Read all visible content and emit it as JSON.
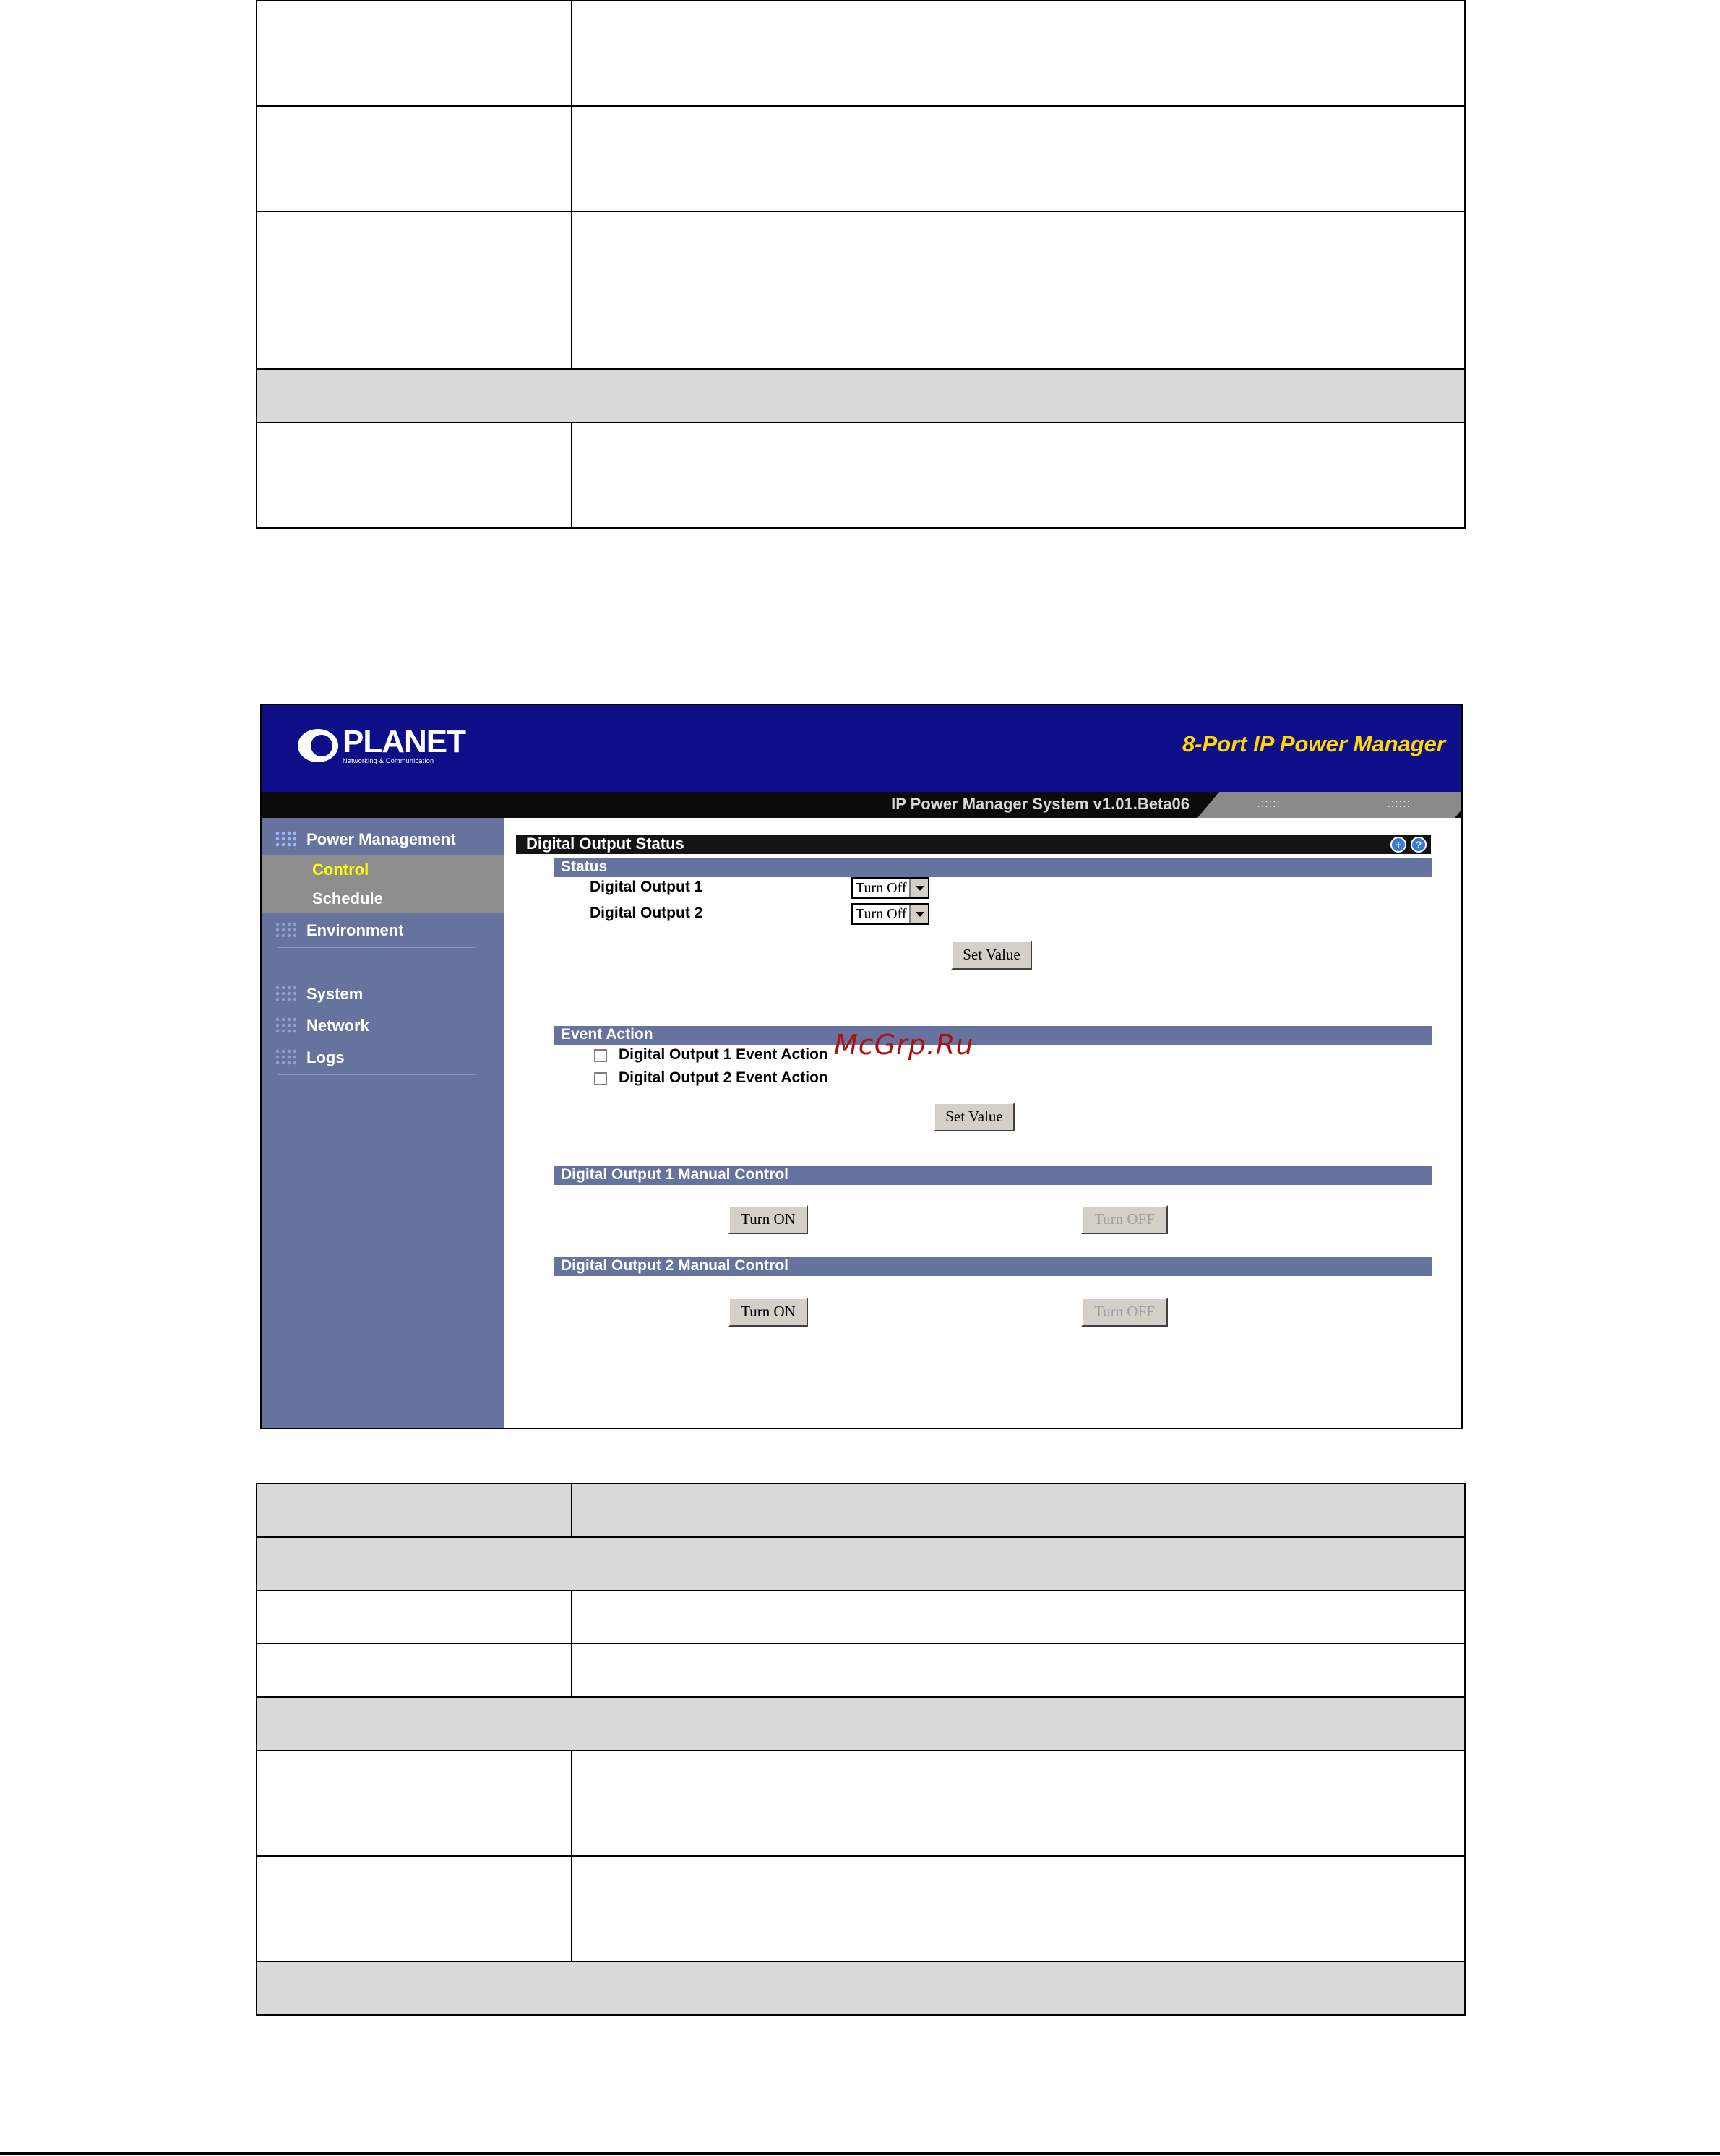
{
  "app": {
    "logo_text": "PLANET",
    "logo_subtitle": "Networking & Communication",
    "product_title": "8-Port IP Power Manager",
    "version": "IP Power Manager System v1.01.Beta06"
  },
  "sidebar": {
    "items": [
      {
        "label": "Power Management"
      },
      {
        "label": "Environment"
      },
      {
        "label": "System"
      },
      {
        "label": "Network"
      },
      {
        "label": "Logs"
      }
    ],
    "sub_items": [
      {
        "label": "Control",
        "color": "#ffff00"
      },
      {
        "label": "Schedule",
        "color": "#ffffff"
      }
    ]
  },
  "main": {
    "page_title": "Digital Output Status",
    "status": {
      "header": "Status",
      "rows": [
        {
          "label": "Digital Output 1",
          "value": "Turn Off"
        },
        {
          "label": "Digital Output 2",
          "value": "Turn Off"
        }
      ],
      "set_button": "Set Value"
    },
    "event_action": {
      "header": "Event Action",
      "items": [
        {
          "label": "Digital Output 1 Event Action",
          "checked": false
        },
        {
          "label": "Digital Output 2 Event Action",
          "checked": false
        }
      ],
      "set_button": "Set Value"
    },
    "manual1": {
      "header": "Digital Output 1 Manual Control",
      "on": "Turn ON",
      "off": "Turn OFF"
    },
    "manual2": {
      "header": "Digital Output 2 Manual Control",
      "on": "Turn ON",
      "off": "Turn OFF"
    }
  },
  "watermark": "McGrp.Ru",
  "colors": {
    "header_bg": "#0e0e88",
    "sidebar_bg": "#66739e",
    "product_title": "#ffd800"
  }
}
